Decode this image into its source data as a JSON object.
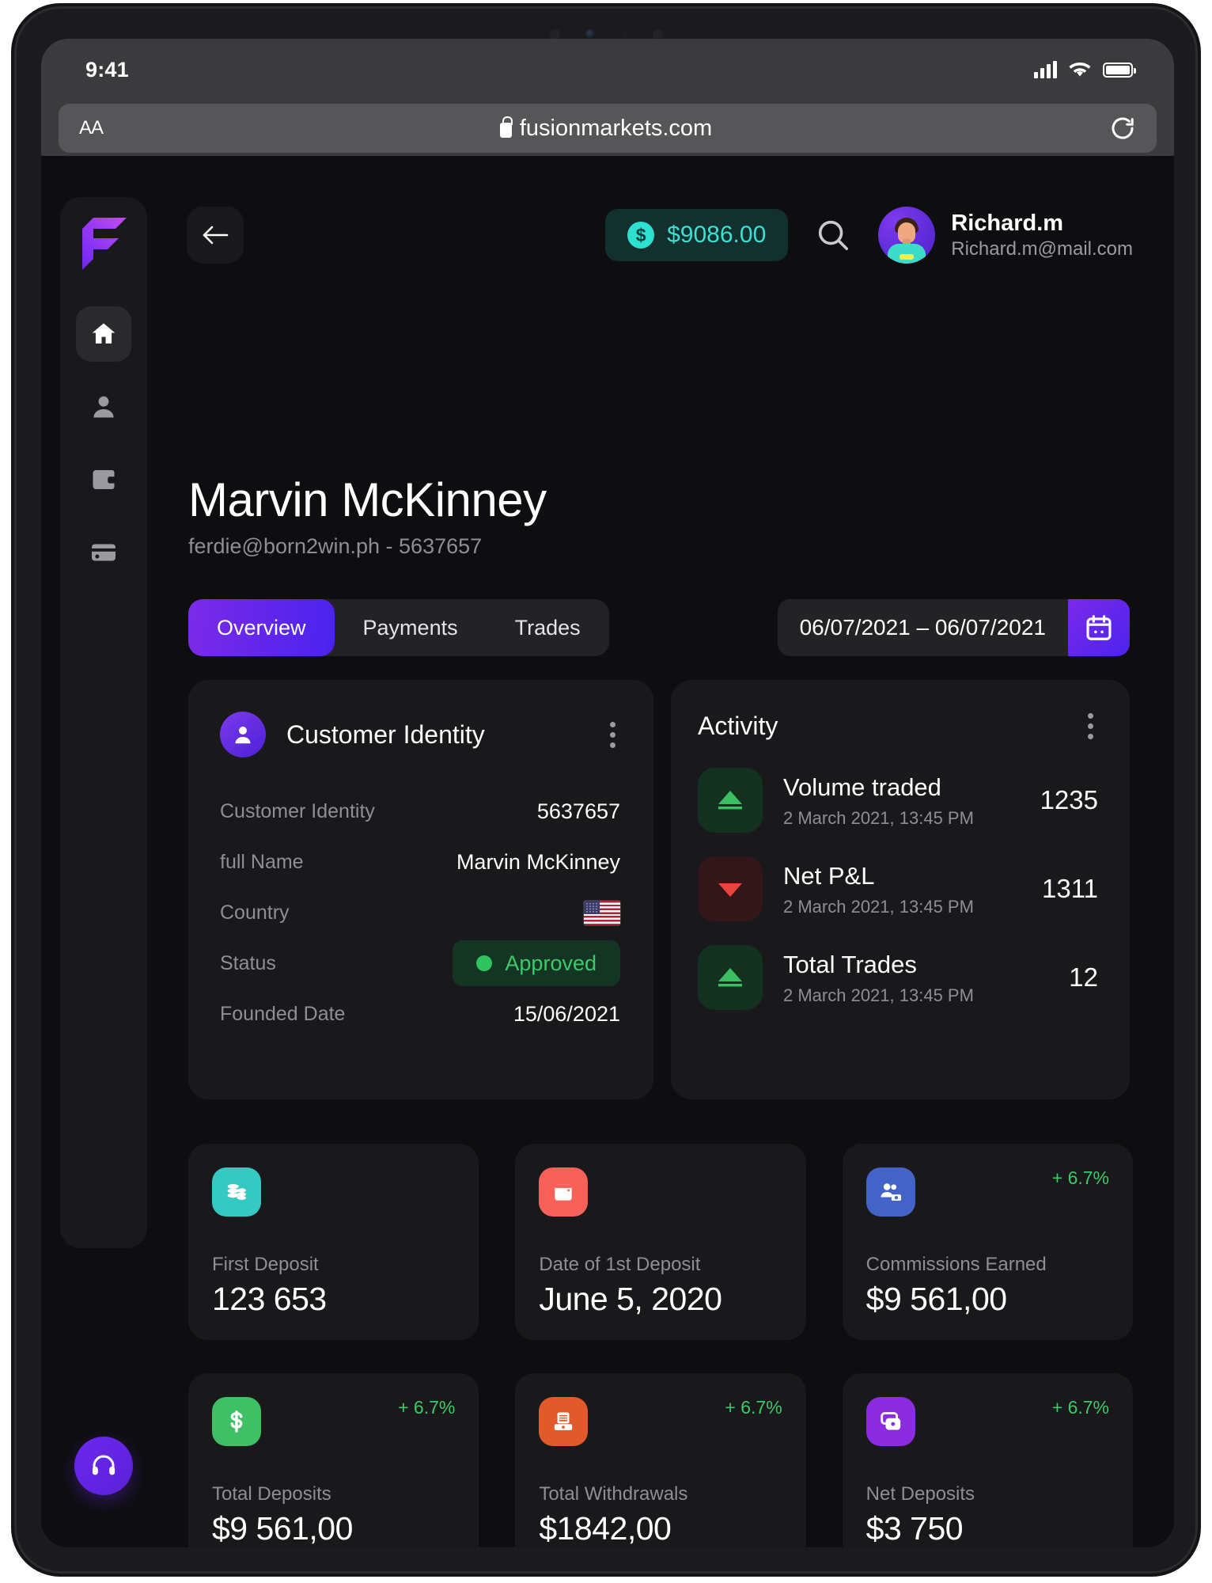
{
  "statusbar": {
    "time": "9:41",
    "signal_icon": "signal-bars-icon",
    "wifi_icon": "wifi-icon",
    "battery_icon": "battery-icon"
  },
  "browser": {
    "text_size_label": "AA",
    "url": "fusionmarkets.com",
    "lock_icon": "lock-icon",
    "reload_icon": "reload-icon"
  },
  "sidebar": {
    "logo": "fusion-markets-logo",
    "items": [
      {
        "name": "home",
        "icon": "home-icon",
        "active": true
      },
      {
        "name": "clients",
        "icon": "user-icon",
        "active": false
      },
      {
        "name": "wallet",
        "icon": "wallet-icon",
        "active": false
      },
      {
        "name": "cards",
        "icon": "card-icon",
        "active": false
      }
    ],
    "support": {
      "icon": "headset-icon",
      "label": "Support"
    }
  },
  "topbar": {
    "back_icon": "arrow-left-icon",
    "balance": "$9086.00",
    "balance_icon": "dollar-coin-icon",
    "search_icon": "search-icon",
    "profile": {
      "name": "Richard.m",
      "email": "Richard.m@mail.com",
      "avatar": "user-avatar"
    }
  },
  "page": {
    "title": "Marvin McKinney",
    "subtitle": "ferdie@born2win.ph - 5637657"
  },
  "tabs": [
    {
      "label": "Overview",
      "active": true
    },
    {
      "label": "Payments",
      "active": false
    },
    {
      "label": "Trades",
      "active": false
    }
  ],
  "daterange": {
    "value": "06/07/2021 – 06/07/2021",
    "calendar_icon": "calendar-icon"
  },
  "identity_card": {
    "title": "Customer Identity",
    "header_icon": "person-icon",
    "menu_icon": "kebab-menu-icon",
    "rows": [
      {
        "label": "Customer Identity",
        "value": "5637657",
        "type": "text"
      },
      {
        "label": "full Name",
        "value": "Marvin McKinney",
        "type": "text"
      },
      {
        "label": "Country",
        "value": "United States",
        "type": "flag"
      },
      {
        "label": "Status",
        "value": "Approved",
        "type": "status"
      },
      {
        "label": "Founded Date",
        "value": "15/06/2021",
        "type": "text"
      }
    ]
  },
  "activity_card": {
    "title": "Activity",
    "menu_icon": "kebab-menu-icon",
    "items": [
      {
        "icon": "triangle-up-icon",
        "direction": "up",
        "name": "Volume traded",
        "time": "2 March 2021, 13:45 PM",
        "value": "1235"
      },
      {
        "icon": "triangle-down-icon",
        "direction": "down",
        "name": "Net P&L",
        "time": "2 March 2021, 13:45 PM",
        "value": "1311"
      },
      {
        "icon": "triangle-up-icon",
        "direction": "up",
        "name": "Total Trades",
        "time": "2 March 2021, 13:45 PM",
        "value": "12"
      }
    ]
  },
  "stats": [
    {
      "icon": "coins-stack-icon",
      "color": "#35c9c4",
      "delta": "",
      "label": "First Deposit",
      "value": "123 653"
    },
    {
      "icon": "calendar-icon",
      "color": "#f8605a",
      "delta": "",
      "label": "Date of 1st Deposit",
      "value": "June 5, 2020"
    },
    {
      "icon": "people-money-icon",
      "color": "#4463c9",
      "delta": "+ 6.7%",
      "label": "Commissions Earned",
      "value": "$9 561,00"
    },
    {
      "icon": "dollar-sign-icon",
      "color": "#3fbf66",
      "delta": "+ 6.7%",
      "label": "Total Deposits",
      "value": "$9 561,00"
    },
    {
      "icon": "cash-register-icon",
      "color": "#e2592b",
      "delta": "+ 6.7%",
      "label": "Total Withdrawals",
      "value": "$1842,00"
    },
    {
      "icon": "wallet-cards-icon",
      "color": "#8b2ce0",
      "delta": "+ 6.7%",
      "label": "Net Deposits",
      "value": "$3 750"
    }
  ],
  "colors": {
    "accent_purple": "#6d28f0",
    "accent_teal": "#3ce0d3",
    "positive_green": "#3cc96a",
    "negative_red": "#e8453c",
    "card_bg": "#19191b",
    "page_bg": "#0e0e10"
  }
}
